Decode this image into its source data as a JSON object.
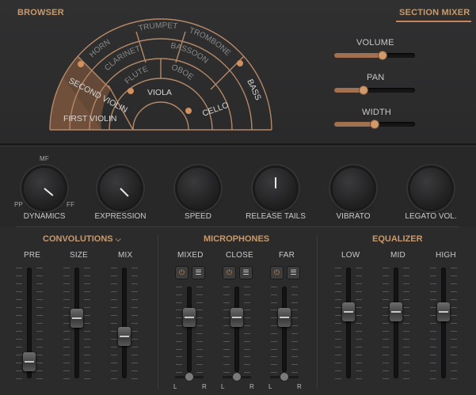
{
  "browser": {
    "title": "BROWSER",
    "instruments": {
      "horn": "HORN",
      "trumpet": "TRUMPET",
      "trombone": "TROMBONE",
      "clarinet": "CLARINET",
      "bassoon": "BASSOON",
      "flute": "FLUTE",
      "oboe": "OBOE",
      "second_violin": "SECOND VIOLIN",
      "viola": "VIOLA",
      "bass": "BASS",
      "first_violin": "FIRST VIOLIN",
      "cello": "CELLO"
    }
  },
  "section_mixer": {
    "title": "SECTION MIXER",
    "volume": {
      "label": "VOLUME",
      "value": 0.6
    },
    "pan": {
      "label": "PAN",
      "value": 0.36
    },
    "width": {
      "label": "WIDTH",
      "value": 0.5
    }
  },
  "knobs": [
    {
      "label": "DYNAMICS",
      "top_mark": "MF",
      "min_mark": "PP",
      "max_mark": "FF"
    },
    {
      "label": "EXPRESSION"
    },
    {
      "label": "SPEED"
    },
    {
      "label": "RELEASE TAILS"
    },
    {
      "label": "VIBRATO"
    },
    {
      "label": "LEGATO VOL."
    }
  ],
  "convolutions": {
    "title": "CONVOLUTIONS",
    "faders": [
      {
        "label": "PRE",
        "value": 0.08
      },
      {
        "label": "SIZE",
        "value": 0.55
      },
      {
        "label": "MIX",
        "value": 0.35
      }
    ]
  },
  "microphones": {
    "title": "MICROPHONES",
    "faders": [
      {
        "label": "MIXED",
        "value": 0.68
      },
      {
        "label": "CLOSE",
        "value": 0.68
      },
      {
        "label": "FAR",
        "value": 0.68
      }
    ],
    "pan_left": "L",
    "pan_right": "R",
    "power_icon": "power-icon",
    "list_icon": "list-icon",
    "colors": {
      "power": "#c8835a"
    }
  },
  "equalizer": {
    "title": "EQUALIZER",
    "faders": [
      {
        "label": "LOW",
        "value": 0.62
      },
      {
        "label": "MID",
        "value": 0.62
      },
      {
        "label": "HIGH",
        "value": 0.62
      }
    ]
  },
  "colors": {
    "accent": "#c89a6e",
    "accent_line": "#c8835a",
    "background": "#2b2b2c"
  }
}
